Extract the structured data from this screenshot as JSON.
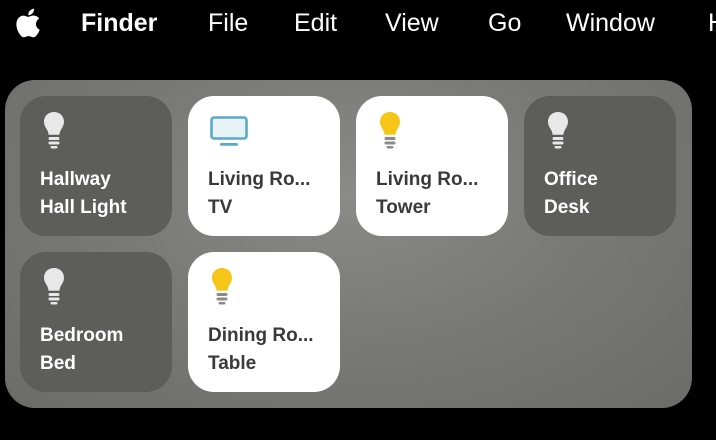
{
  "menubar": {
    "app_name": "Finder",
    "items": [
      "File",
      "Edit",
      "View",
      "Go",
      "Window",
      "H"
    ]
  },
  "colors": {
    "bulb_on": "#f5c518",
    "bulb_off": "#e8e8e8",
    "tv_icon": "#5aa9c7",
    "tile_off_bg": "#5d5d5b",
    "tile_on_bg": "#ffffff"
  },
  "tiles": [
    {
      "room": "Hallway",
      "device": "Hall Light",
      "state": "off",
      "icon": "lightbulb-icon"
    },
    {
      "room": "Living Ro...",
      "device": "TV",
      "state": "on",
      "icon": "tv-icon"
    },
    {
      "room": "Living Ro...",
      "device": "Tower",
      "state": "on",
      "icon": "lightbulb-icon"
    },
    {
      "room": "Office",
      "device": "Desk",
      "state": "off",
      "icon": "lightbulb-icon"
    },
    {
      "room": "Bedroom",
      "device": "Bed",
      "state": "off",
      "icon": "lightbulb-icon"
    },
    {
      "room": "Dining Ro...",
      "device": "Table",
      "state": "on",
      "icon": "lightbulb-icon"
    }
  ]
}
